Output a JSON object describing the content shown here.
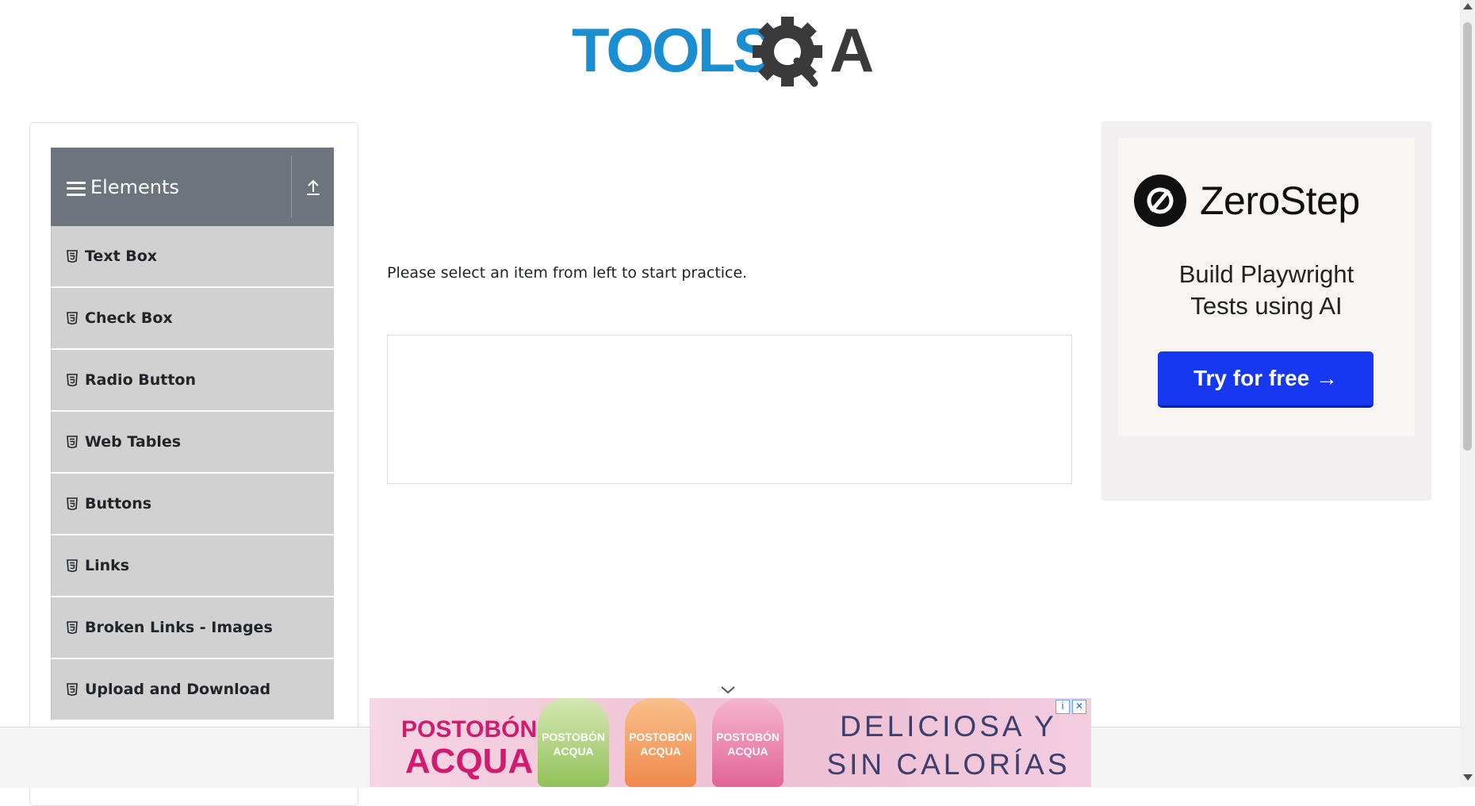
{
  "header": {
    "logo_text": "TOOLSQA"
  },
  "sidebar": {
    "group_title": "Elements",
    "items": [
      {
        "label": "Text Box"
      },
      {
        "label": "Check Box"
      },
      {
        "label": "Radio Button"
      },
      {
        "label": "Web Tables"
      },
      {
        "label": "Buttons"
      },
      {
        "label": "Links"
      },
      {
        "label": "Broken Links - Images"
      },
      {
        "label": "Upload and Download"
      }
    ]
  },
  "main": {
    "prompt": "Please select an item from left to start practice."
  },
  "ad_right": {
    "brand": "ZeroStep",
    "headline_line1": "Build Playwright",
    "headline_line2": "Tests using AI",
    "cta": "Try for free →"
  },
  "ad_bottom": {
    "brand_line1": "POSTOBÓN",
    "brand_line2": "ACQUA",
    "slogan_line1": "DELICIOSA Y",
    "slogan_line2": "SIN CALORÍAS",
    "bottle_label": "POSTOBÓN ACQUA",
    "adchoices_icon": "info-icon",
    "close_icon": "close-icon"
  },
  "colors": {
    "logo_blue": "#1b8ed1",
    "logo_dark": "#3a3a3a",
    "sidebar_header": "#6c757d",
    "menu_item_bg": "#d1d1d1",
    "cta_blue": "#1538f0",
    "ad_pink": "#d01b71"
  }
}
